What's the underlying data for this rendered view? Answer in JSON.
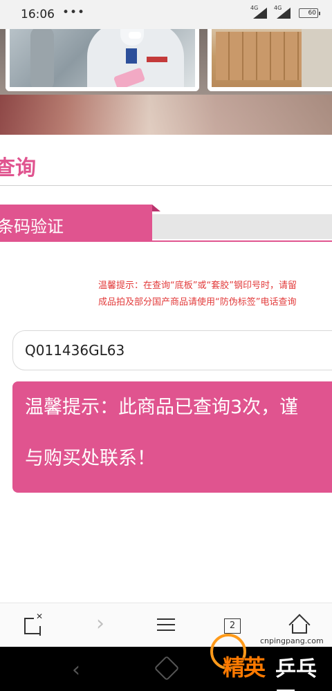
{
  "status_bar": {
    "time": "16:06",
    "dots": "•••",
    "signal_1": "4G",
    "signal_2": "4G",
    "battery": "60"
  },
  "page": {
    "title": "查询"
  },
  "tabs": {
    "active_label": "条码验证"
  },
  "notice": {
    "line1": "温馨提示：在查询“底板”或“套胶”钢印号时，请留",
    "line2": "成品拍及部分国产商品请使用“防伪标签”电话查询"
  },
  "code_input": {
    "value": "Q011436GL63"
  },
  "result": {
    "line1": "温馨提示：此商品已查询3次，谨",
    "line2": "与购买处联系！"
  },
  "browser_toolbar": {
    "forward_glyph": "›",
    "tab_count": "2"
  },
  "watermark": {
    "url": "cnpingpang.com",
    "brand_elite": "精英",
    "brand_pingpang": "乒乓网"
  },
  "nav_bar": {
    "back_glyph": "‹"
  },
  "colors": {
    "accent": "#e0548f",
    "notice_red": "#e23b3b"
  }
}
